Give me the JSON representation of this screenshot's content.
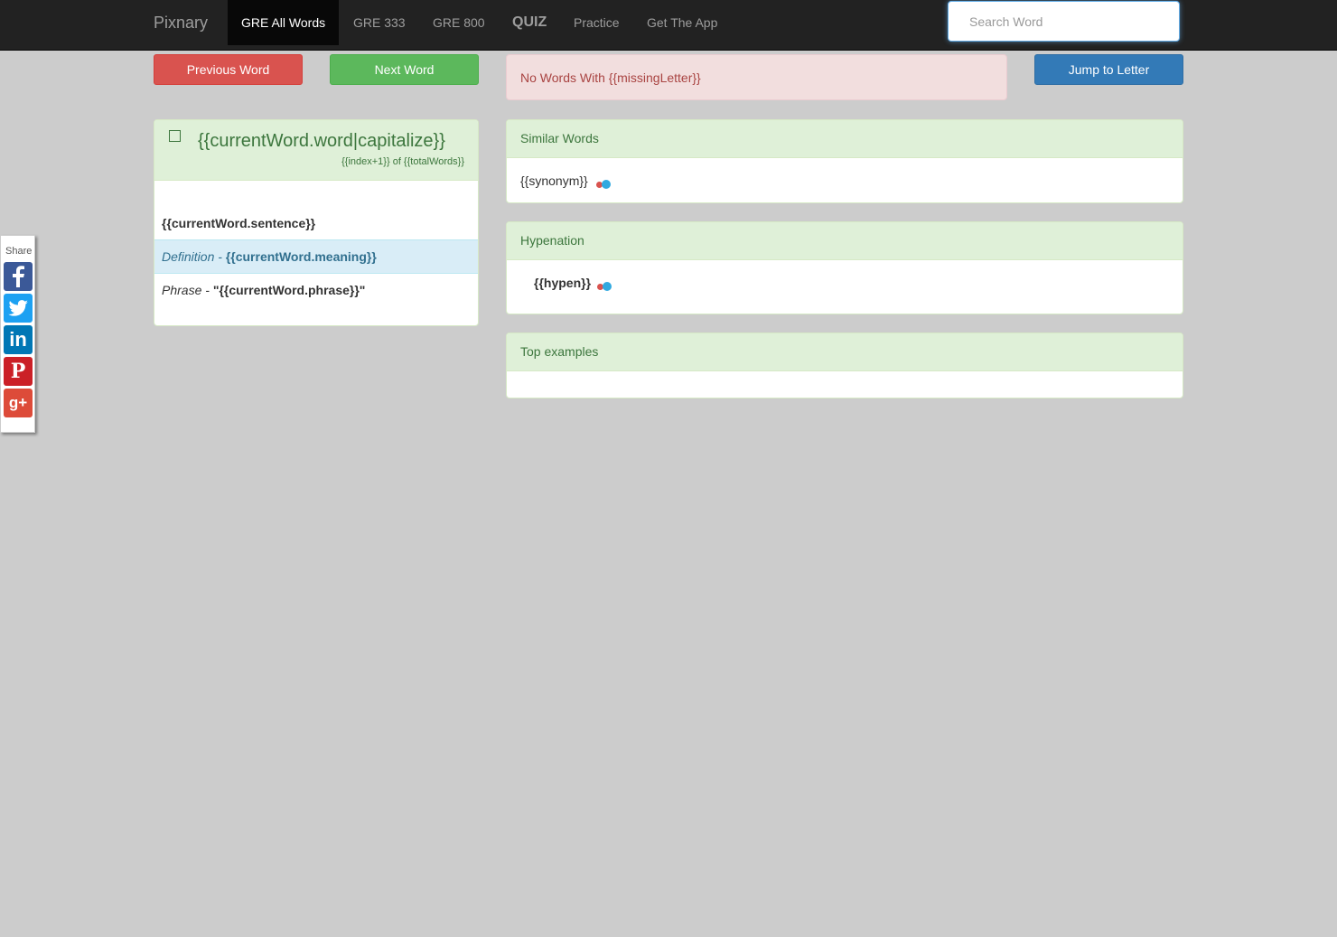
{
  "nav": {
    "brand": "Pixnary",
    "items": [
      {
        "label": "GRE All Words"
      },
      {
        "label": "GRE 333"
      },
      {
        "label": "GRE 800"
      },
      {
        "label": "QUIZ"
      },
      {
        "label": "Practice"
      },
      {
        "label": "Get The App"
      }
    ],
    "search_placeholder": "Search Word"
  },
  "controls": {
    "prev_label": "Previous Word",
    "next_label": "Next Word",
    "jump_label": "Jump to Letter",
    "alert_text": "No Words With {{missingLetter}}"
  },
  "word": {
    "title": "{{currentWord.word|capitalize}}",
    "count": "{{index+1}} of {{totalWords}}",
    "sentence": "{{currentWord.sentence}}",
    "definition_label": "Definition -",
    "definition_value": "{{currentWord.meaning}}",
    "phrase_label": "Phrase -",
    "phrase_value": "\"{{currentWord.phrase}}\""
  },
  "similar": {
    "heading": "Similar Words",
    "item": "{{synonym}}"
  },
  "hypenation": {
    "heading": "Hypenation",
    "item": "{{hypen}}"
  },
  "examples": {
    "heading": "Top examples"
  },
  "share": {
    "label": "Share",
    "icons": [
      "facebook-icon",
      "twitter-icon",
      "linkedin-icon",
      "pinterest-icon",
      "google-plus-icon"
    ]
  },
  "colors": {
    "danger": "#d9534f",
    "success": "#5cb85c",
    "primary": "#337ab7",
    "navbar": "#222222"
  }
}
